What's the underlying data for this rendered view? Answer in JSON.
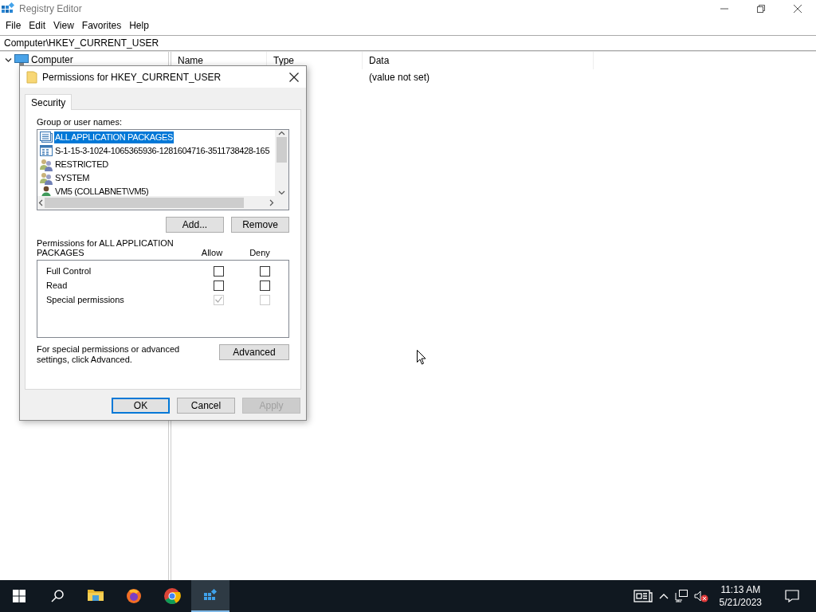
{
  "window": {
    "title": "Registry Editor"
  },
  "menu": [
    "File",
    "Edit",
    "View",
    "Favorites",
    "Help"
  ],
  "address": "Computer\\HKEY_CURRENT_USER",
  "tree": [
    {
      "label": "Computer",
      "expanded": true
    }
  ],
  "list": {
    "columns": [
      "Name",
      "Type",
      "Data"
    ],
    "rows": [
      {
        "data": "(value not set)"
      }
    ]
  },
  "dialog": {
    "title": "Permissions for HKEY_CURRENT_USER",
    "tabs": [
      {
        "label": "Security",
        "selected": true
      }
    ],
    "group_label": "Group or user names:",
    "principals": [
      {
        "name": "ALL APPLICATION PACKAGES",
        "kind": "package",
        "selected": true
      },
      {
        "name": "S-1-15-3-1024-1065365936-1281604716-3511738428-165",
        "kind": "capability",
        "selected": false
      },
      {
        "name": "RESTRICTED",
        "kind": "group",
        "selected": false
      },
      {
        "name": "SYSTEM",
        "kind": "group",
        "selected": false
      },
      {
        "name": "VM5 (COLLABNET\\VM5)",
        "kind": "user",
        "selected": false
      }
    ],
    "list_buttons": [
      "Add...",
      "Remove"
    ],
    "permissions_label": "Permissions for ALL APPLICATION PACKAGES",
    "permission_columns": [
      "Allow",
      "Deny"
    ],
    "permissions": [
      {
        "name": "Full Control",
        "allow": {
          "checked": false,
          "disabled": false
        },
        "deny": {
          "checked": false,
          "disabled": false
        }
      },
      {
        "name": "Read",
        "allow": {
          "checked": false,
          "disabled": false
        },
        "deny": {
          "checked": false,
          "disabled": false
        }
      },
      {
        "name": "Special permissions",
        "allow": {
          "checked": true,
          "disabled": true
        },
        "deny": {
          "checked": false,
          "disabled": true
        }
      }
    ],
    "advanced_note": "For special permissions or advanced settings, click Advanced.",
    "advanced_button": "Advanced",
    "footer_buttons": [
      {
        "label": "OK",
        "kind": "default",
        "disabled": false
      },
      {
        "label": "Cancel",
        "kind": "normal",
        "disabled": false
      },
      {
        "label": "Apply",
        "kind": "normal",
        "disabled": true
      }
    ]
  },
  "taskbar": {
    "apps": [
      {
        "kind": "files",
        "active": false
      },
      {
        "kind": "firefox",
        "active": false
      },
      {
        "kind": "chrome",
        "active": false
      },
      {
        "kind": "regedit",
        "active": true
      }
    ],
    "time": "11:13 AM",
    "date": "5/21/2023"
  }
}
